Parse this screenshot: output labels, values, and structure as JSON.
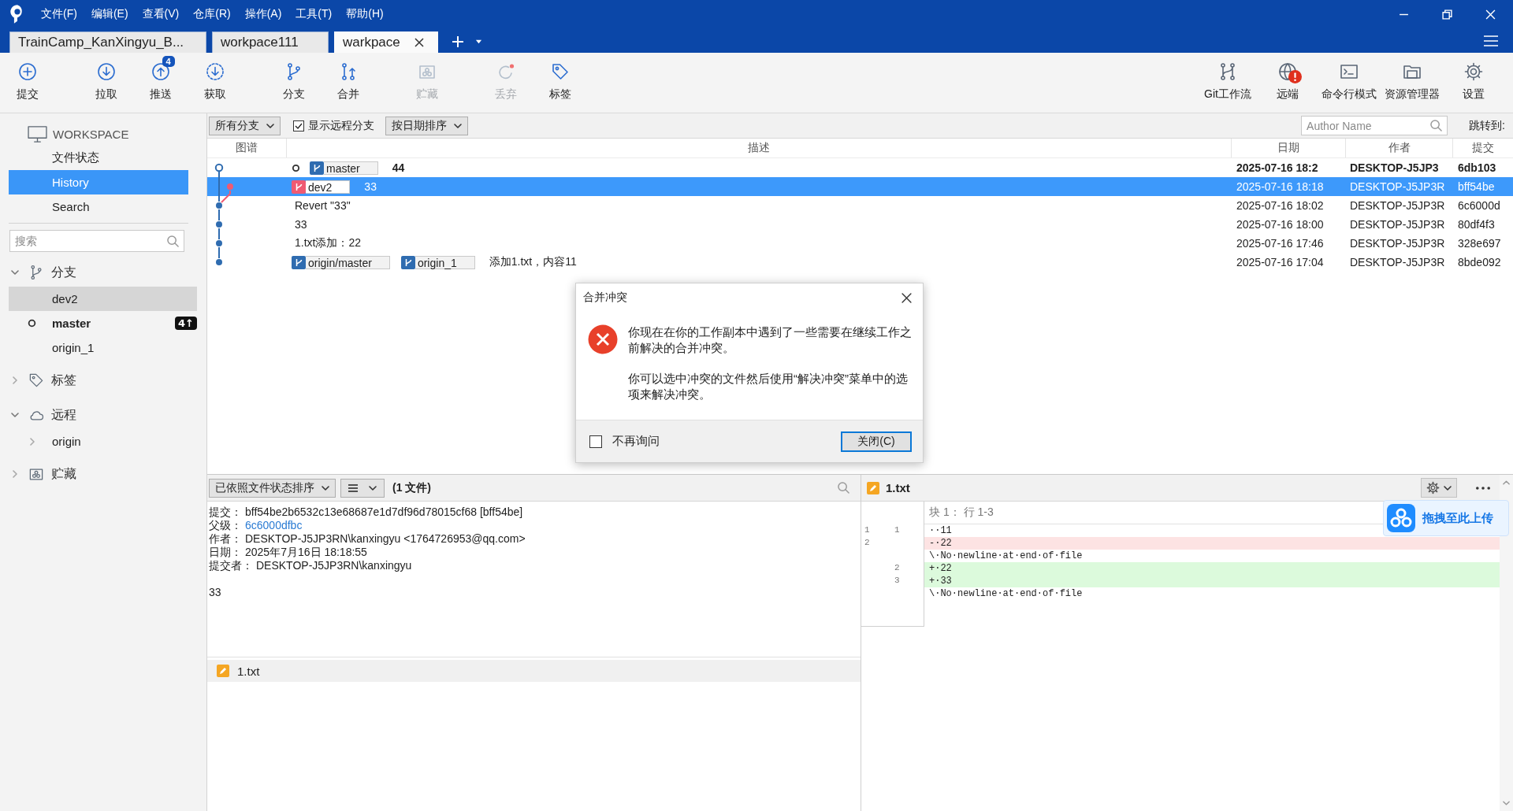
{
  "app": {
    "menu": [
      "文件(F)",
      "编辑(E)",
      "查看(V)",
      "仓库(R)",
      "操作(A)",
      "工具(T)",
      "帮助(H)"
    ]
  },
  "tabs": [
    {
      "label": "TrainCamp_KanXingyu_B...",
      "selected": false
    },
    {
      "label": "workpace111",
      "selected": false
    },
    {
      "label": "warkpace",
      "selected": true
    }
  ],
  "toolbar": {
    "left": [
      {
        "label": "提交",
        "disabled": false
      },
      {
        "label": "拉取",
        "disabled": false
      },
      {
        "label": "推送",
        "disabled": false,
        "badge": "4"
      },
      {
        "label": "获取",
        "disabled": false
      },
      {
        "label": "分支",
        "disabled": false
      },
      {
        "label": "合并",
        "disabled": false
      },
      {
        "label": "贮藏",
        "disabled": true
      },
      {
        "label": "丢弃",
        "disabled": true
      },
      {
        "label": "标签",
        "disabled": false
      }
    ],
    "right": [
      {
        "label": "Git工作流",
        "alert": false
      },
      {
        "label": "远端",
        "alert": true
      },
      {
        "label": "命令行模式",
        "alert": false
      },
      {
        "label": "资源管理器",
        "alert": false
      },
      {
        "label": "设置",
        "alert": false
      }
    ]
  },
  "sidebar": {
    "workspace": {
      "title": "WORKSPACE",
      "items": [
        {
          "label": "文件状态",
          "selected": false
        },
        {
          "label": "History",
          "selected": true
        },
        {
          "label": "Search",
          "selected": false
        }
      ]
    },
    "search": {
      "placeholder": "搜索"
    },
    "sections": [
      {
        "label": "分支",
        "expanded": true,
        "children": [
          {
            "label": "dev2",
            "selected": true,
            "current": false
          },
          {
            "label": "master",
            "selected": false,
            "current": true,
            "badge": "4↑"
          },
          {
            "label": "origin_1",
            "selected": false,
            "current": false
          }
        ]
      },
      {
        "label": "标签",
        "expanded": false
      },
      {
        "label": "远程",
        "expanded": true,
        "children": [
          {
            "label": "origin",
            "selected": false,
            "current": false,
            "expanded": false
          }
        ]
      },
      {
        "label": "贮藏",
        "expanded": false
      }
    ]
  },
  "history": {
    "branch_filter": "所有分支",
    "show_remote": {
      "label": "显示远程分支",
      "checked": true
    },
    "sort": "按日期排序",
    "author_search": {
      "placeholder": "Author Name"
    },
    "jump_label": "跳转到:",
    "columns": [
      "图谱",
      "描述",
      "日期",
      "作者",
      "提交"
    ],
    "rows": [
      {
        "kind": "head",
        "color": "#2f6cb0",
        "selected": false,
        "refs": [
          {
            "label": "master",
            "color": "#2f6cb0",
            "current": true
          }
        ],
        "message": "44",
        "date": "2025-07-16 18:2",
        "author": "DESKTOP-J5JP3",
        "hash": "6db103"
      },
      {
        "kind": "branch",
        "color": "#ef5a72",
        "selected": true,
        "refs": [
          {
            "label": "dev2",
            "color": "#ef5a72",
            "current": false
          }
        ],
        "message": "33",
        "date": "2025-07-16 18:18",
        "author": "DESKTOP-J5JP3R",
        "hash": "bff54be"
      },
      {
        "kind": "commit",
        "color": "#2f6cb0",
        "selected": false,
        "message": "Revert \"33\"",
        "date": "2025-07-16 18:02",
        "author": "DESKTOP-J5JP3R",
        "hash": "6c6000d"
      },
      {
        "kind": "commit",
        "color": "#2f6cb0",
        "selected": false,
        "message": "33",
        "date": "2025-07-16 18:00",
        "author": "DESKTOP-J5JP3R",
        "hash": "80df4f3"
      },
      {
        "kind": "commit",
        "color": "#2f6cb0",
        "selected": false,
        "message": "1.txt添加：22",
        "date": "2025-07-16 17:46",
        "author": "DESKTOP-J5JP3R",
        "hash": "328e697"
      },
      {
        "kind": "commit",
        "color": "#2f6cb0",
        "selected": false,
        "refs": [
          {
            "label": "origin/master",
            "color": "#2f6cb0",
            "current": false
          },
          {
            "label": "origin_1",
            "color": "#2f6cb0",
            "current": false
          }
        ],
        "message": "添加1.txt，内容11",
        "date": "2025-07-16 17:04",
        "author": "DESKTOP-J5JP3R",
        "hash": "8bde092"
      }
    ]
  },
  "details": {
    "sort": "已依照文件状态排序",
    "file_count": "(1 文件)",
    "fields": [
      {
        "kind": "text",
        "label": "提交：",
        "value": "bff54be2b6532c13e68687e1d7df96d78015cf68 [bff54be]"
      },
      {
        "kind": "link",
        "label": "父级：",
        "value": "6c6000dfbc"
      },
      {
        "kind": "text",
        "label": "作者：",
        "value": "DESKTOP-J5JP3RN\\kanxingyu <1764726953@qq.com>"
      },
      {
        "kind": "text",
        "label": "日期：",
        "value": "2025年7月16日 18:18:55"
      },
      {
        "kind": "text",
        "label": "提交者：",
        "value": "DESKTOP-J5JP3RN\\kanxingyu"
      }
    ],
    "message": "33",
    "files": [
      {
        "name": "1.txt",
        "kind": "modified"
      }
    ]
  },
  "diff": {
    "file": {
      "name": "1.txt",
      "kind": "modified"
    },
    "hunk": "块 1： 行 1-3",
    "lines": [
      {
        "kind": "context",
        "old": "1",
        "new": "1",
        "text": "··11"
      },
      {
        "kind": "removed",
        "old": "2",
        "text": "-·22"
      },
      {
        "kind": "note",
        "text": "\\·No·newline·at·end·of·file"
      },
      {
        "kind": "added",
        "new": "2",
        "text": "+·22"
      },
      {
        "kind": "added",
        "new": "3",
        "text": "+·33"
      },
      {
        "kind": "note",
        "text": "\\·No·newline·at·end·of·file"
      }
    ]
  },
  "upload_widget": {
    "label": "拖拽至此上传"
  },
  "dialog": {
    "title": "合并冲突",
    "messages": [
      "你现在在你的工作副本中遇到了一些需要在继续工作之前解决的合并冲突。",
      "你可以选中冲突的文件然后使用“解决冲突”菜单中的选项来解决冲突。"
    ],
    "dont_ask": {
      "label": "不再询问",
      "checked": false
    },
    "button": "关闭(C)"
  }
}
